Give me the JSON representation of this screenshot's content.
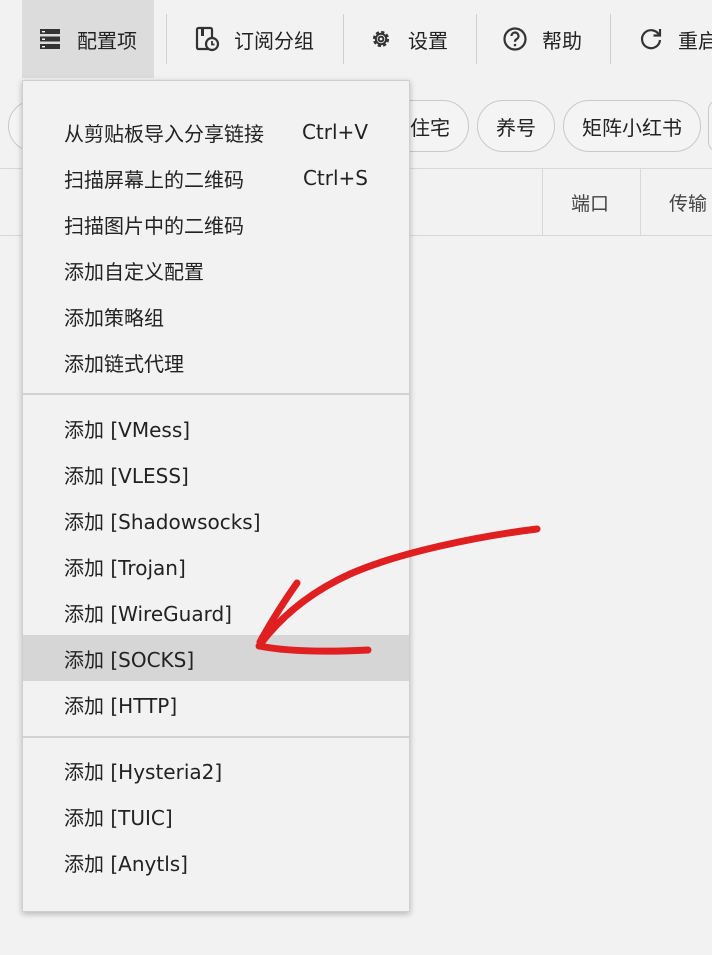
{
  "toolbar": {
    "items": [
      {
        "label": "配置项",
        "icon": "server-list-icon"
      },
      {
        "label": "订阅分组",
        "icon": "subscription-group-icon"
      },
      {
        "label": "设置",
        "icon": "gear-icon"
      },
      {
        "label": "帮助",
        "icon": "help-circle-icon"
      },
      {
        "label": "重启",
        "icon": "restart-icon"
      }
    ]
  },
  "filters": {
    "chips": [
      "住宅",
      "养号",
      "矩阵小红书"
    ]
  },
  "table": {
    "headers": [
      "端口",
      "传输"
    ]
  },
  "menu": {
    "group1": [
      {
        "label": "从剪贴板导入分享链接",
        "shortcut": "Ctrl+V"
      },
      {
        "label": "扫描屏幕上的二维码",
        "shortcut": "Ctrl+S"
      },
      {
        "label": "扫描图片中的二维码"
      },
      {
        "label": "添加自定义配置"
      },
      {
        "label": "添加策略组"
      },
      {
        "label": "添加链式代理"
      }
    ],
    "group2": [
      {
        "label": "添加 [VMess]"
      },
      {
        "label": "添加 [VLESS]"
      },
      {
        "label": "添加 [Shadowsocks]"
      },
      {
        "label": "添加 [Trojan]"
      },
      {
        "label": "添加 [WireGuard]"
      },
      {
        "label": "添加 [SOCKS]",
        "highlighted": true
      },
      {
        "label": "添加 [HTTP]"
      }
    ],
    "group3": [
      {
        "label": "添加 [Hysteria2]"
      },
      {
        "label": "添加 [TUIC]"
      },
      {
        "label": "添加 [Anytls]"
      }
    ]
  },
  "annotation": {
    "color": "#e02020",
    "icon": "red-arrow-annotation"
  },
  "colors": {
    "highlight": "#d6d6d6",
    "background": "#f2f2f2"
  }
}
